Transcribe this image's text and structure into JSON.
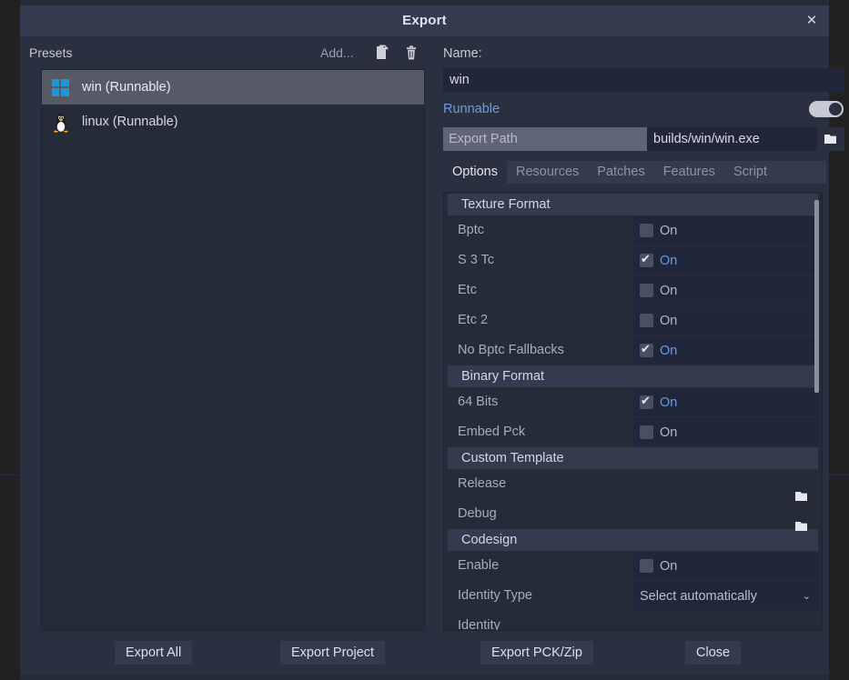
{
  "window": {
    "title": "Export",
    "close_icon": "close-icon"
  },
  "presets": {
    "heading": "Presets",
    "add_label": "Add...",
    "duplicate_icon": "duplicate-icon",
    "delete_icon": "trash-icon",
    "items": [
      {
        "label": "win (Runnable)",
        "icon": "windows-logo-icon",
        "selected": true
      },
      {
        "label": "linux (Runnable)",
        "icon": "linux-tux-icon",
        "selected": false
      }
    ]
  },
  "detail": {
    "name_label": "Name:",
    "name_value": "win",
    "name_placeholder": "",
    "runnable_label": "Runnable",
    "runnable_on": true,
    "export_path_label": "Export Path",
    "export_path_value": "builds/win/win.exe",
    "export_path_browse_icon": "folder-icon",
    "tabs": [
      {
        "label": "Options",
        "active": true
      },
      {
        "label": "Resources",
        "active": false
      },
      {
        "label": "Patches",
        "active": false
      },
      {
        "label": "Features",
        "active": false
      },
      {
        "label": "Script",
        "active": false
      }
    ]
  },
  "options": {
    "sections": [
      {
        "heading": "Texture Format",
        "rows": [
          {
            "name": "Bptc",
            "kind": "checkbox",
            "checked": false,
            "value_label": "On"
          },
          {
            "name": "S 3 Tc",
            "kind": "checkbox",
            "checked": true,
            "value_label": "On"
          },
          {
            "name": "Etc",
            "kind": "checkbox",
            "checked": false,
            "value_label": "On"
          },
          {
            "name": "Etc 2",
            "kind": "checkbox",
            "checked": false,
            "value_label": "On"
          },
          {
            "name": "No Bptc Fallbacks",
            "kind": "checkbox",
            "checked": true,
            "value_label": "On"
          }
        ]
      },
      {
        "heading": "Binary Format",
        "rows": [
          {
            "name": "64 Bits",
            "kind": "checkbox",
            "checked": true,
            "value_label": "On"
          },
          {
            "name": "Embed Pck",
            "kind": "checkbox",
            "checked": false,
            "value_label": "On"
          }
        ]
      },
      {
        "heading": "Custom Template",
        "rows": [
          {
            "name": "Release",
            "kind": "path",
            "value": "",
            "browse_icon": "folder-icon"
          },
          {
            "name": "Debug",
            "kind": "path",
            "value": "",
            "browse_icon": "folder-icon"
          }
        ]
      },
      {
        "heading": "Codesign",
        "rows": [
          {
            "name": "Enable",
            "kind": "checkbox",
            "checked": false,
            "value_label": "On"
          },
          {
            "name": "Identity Type",
            "kind": "dropdown",
            "value": "Select automatically",
            "arrow_icon": "chevron-down-icon"
          },
          {
            "name": "Identity",
            "kind": "path",
            "value": "",
            "browse_icon": "folder-icon"
          }
        ]
      }
    ],
    "scrollbar": {
      "name": "options-scrollbar"
    }
  },
  "footer": {
    "buttons": [
      {
        "label": "Export All",
        "name": "export-all-button"
      },
      {
        "label": "Export Project",
        "name": "export-project-button"
      },
      {
        "label": "Export PCK/Zip",
        "name": "export-pck-zip-button"
      },
      {
        "label": "Close",
        "name": "close-button"
      }
    ]
  },
  "colors": {
    "dialog_bg": "#2b3040",
    "titlebar_bg": "#353b4e",
    "panel_bg": "#262b38",
    "field_bg": "#21263a",
    "accent_blue": "#6a9ae0",
    "selected_row": "#555a66",
    "windows_blue": "#2196d6"
  }
}
